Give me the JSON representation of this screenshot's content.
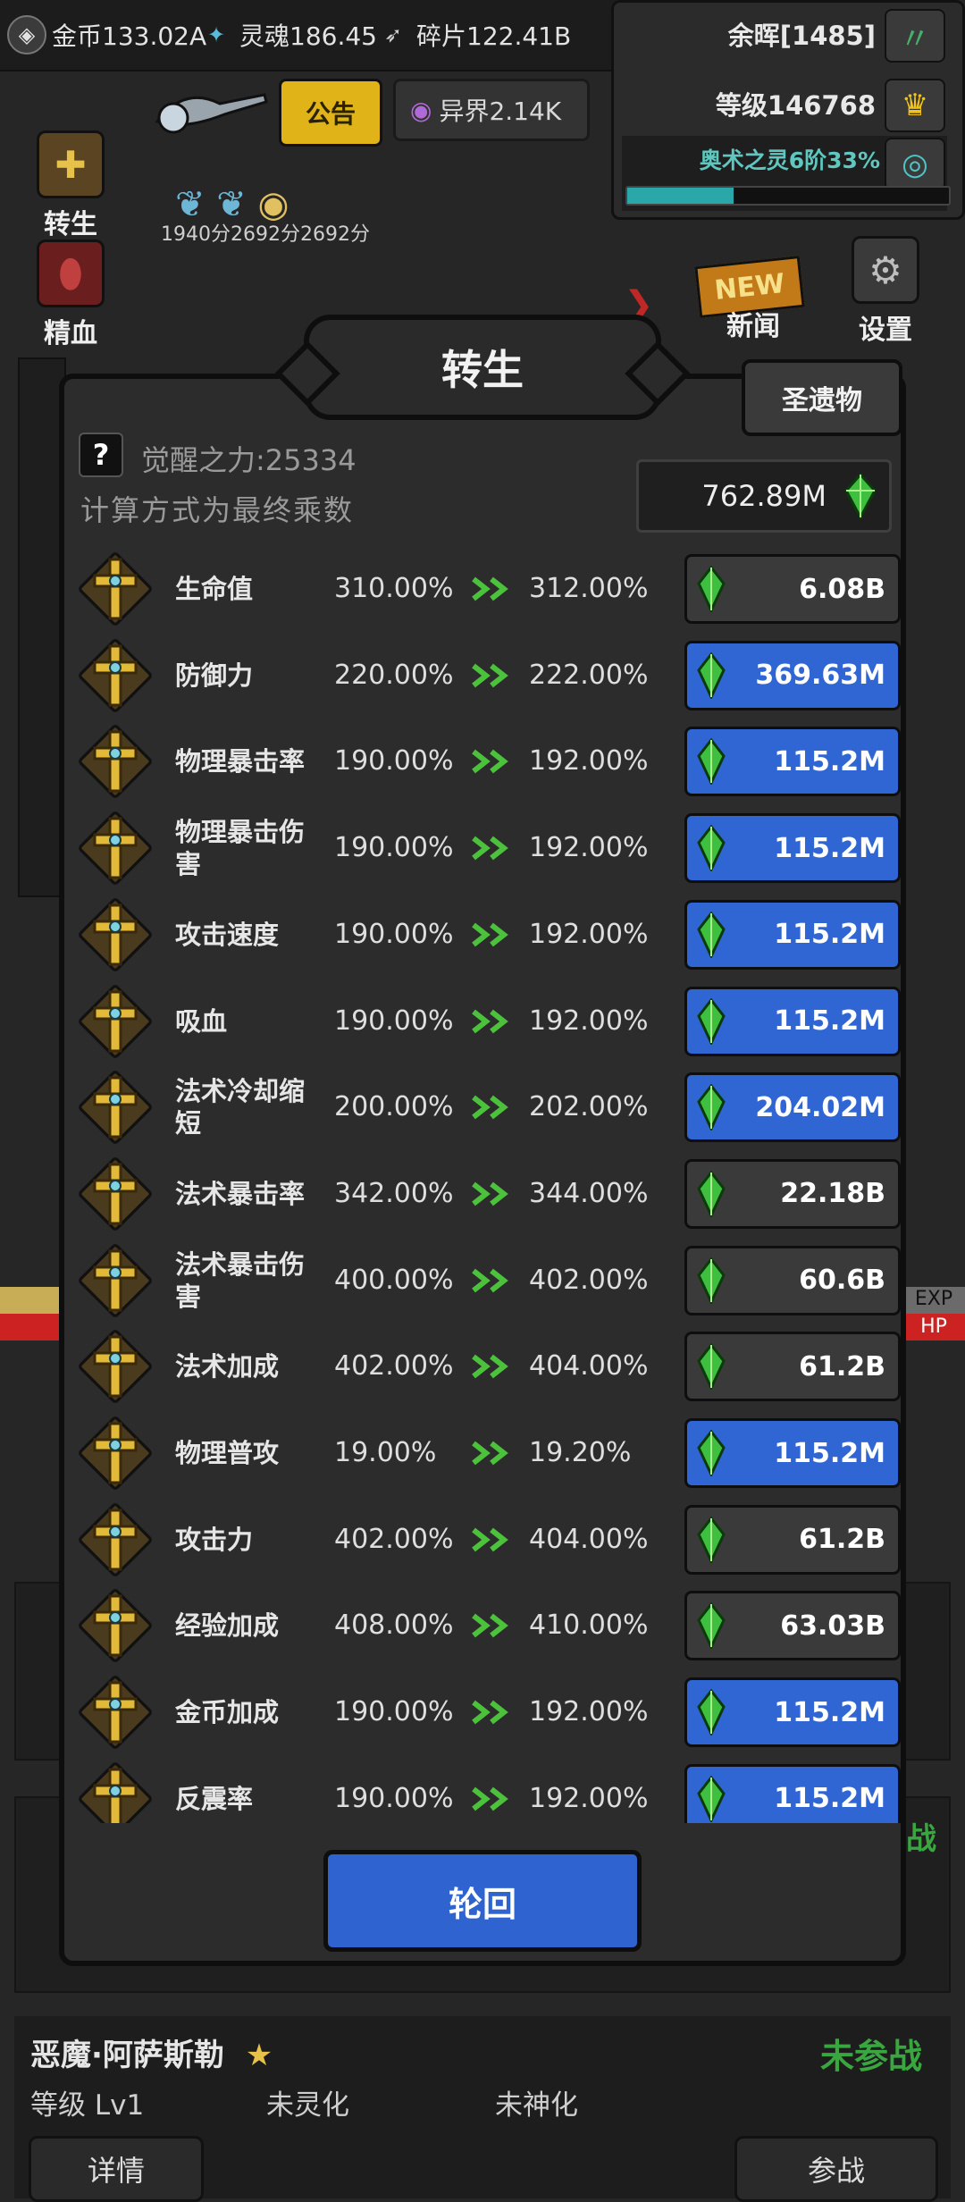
{
  "resources": [
    {
      "name": "gold",
      "label": "金币133.02A",
      "icon": "coin-icon"
    },
    {
      "name": "soul",
      "label": "灵魂186.45",
      "icon": "soul-icon"
    },
    {
      "name": "shard",
      "label": "碎片122.41B",
      "icon": "shard-icon"
    }
  ],
  "stats": {
    "afterglow": "余晖[1485]",
    "level": "等级146768",
    "arcane": "奥术之灵6阶33%",
    "arcane_progress": 0.33
  },
  "notice_label": "公告",
  "otherworld": "异界2.14K",
  "timers": "1940分2692分2692分",
  "menu": {
    "rebirth": "转生",
    "essence": "精血",
    "news": "新闻",
    "settings": "设置",
    "new_badge": "NEW"
  },
  "modal": {
    "title": "转生",
    "relic_label": "圣遗物",
    "awaken": "觉醒之力:25334",
    "calc_note": "计算方式为最终乘数",
    "balance": "762.89M",
    "confirm_label": "轮回"
  },
  "upgrades": [
    {
      "name": "生命值",
      "current": "310.00%",
      "next": "312.00%",
      "cost": "6.08B",
      "affordable": false
    },
    {
      "name": "防御力",
      "current": "220.00%",
      "next": "222.00%",
      "cost": "369.63M",
      "affordable": true
    },
    {
      "name": "物理暴击率",
      "current": "190.00%",
      "next": "192.00%",
      "cost": "115.2M",
      "affordable": true
    },
    {
      "name": "物理暴击伤害",
      "current": "190.00%",
      "next": "192.00%",
      "cost": "115.2M",
      "affordable": true
    },
    {
      "name": "攻击速度",
      "current": "190.00%",
      "next": "192.00%",
      "cost": "115.2M",
      "affordable": true
    },
    {
      "name": "吸血",
      "current": "190.00%",
      "next": "192.00%",
      "cost": "115.2M",
      "affordable": true
    },
    {
      "name": "法术冷却缩短",
      "current": "200.00%",
      "next": "202.00%",
      "cost": "204.02M",
      "affordable": true
    },
    {
      "name": "法术暴击率",
      "current": "342.00%",
      "next": "344.00%",
      "cost": "22.18B",
      "affordable": false
    },
    {
      "name": "法术暴击伤害",
      "current": "400.00%",
      "next": "402.00%",
      "cost": "60.6B",
      "affordable": false
    },
    {
      "name": "法术加成",
      "current": "402.00%",
      "next": "404.00%",
      "cost": "61.2B",
      "affordable": false
    },
    {
      "name": "物理普攻",
      "current": "19.00%",
      "next": "19.20%",
      "cost": "115.2M",
      "affordable": true
    },
    {
      "name": "攻击力",
      "current": "402.00%",
      "next": "404.00%",
      "cost": "61.2B",
      "affordable": false
    },
    {
      "name": "经验加成",
      "current": "408.00%",
      "next": "410.00%",
      "cost": "63.03B",
      "affordable": false
    },
    {
      "name": "金币加成",
      "current": "190.00%",
      "next": "192.00%",
      "cost": "115.2M",
      "affordable": true
    },
    {
      "name": "反震率",
      "current": "190.00%",
      "next": "192.00%",
      "cost": "115.2M",
      "affordable": true
    }
  ],
  "background": {
    "exp_label": "EXP",
    "hp_label": "HP",
    "hero_status_right": "战"
  },
  "bottom_hero": {
    "name": "恶魔·阿萨斯勒",
    "status": "未参战",
    "level": "等级 Lv1",
    "spirit": "未灵化",
    "divine": "未神化",
    "detail_label": "详情",
    "join_label": "参战"
  }
}
